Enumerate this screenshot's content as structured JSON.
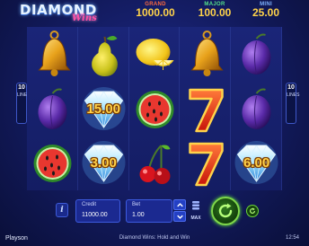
{
  "game": {
    "logo_main": "DIAMOND",
    "logo_sub": "Wins",
    "title": "Diamond Wins: Hold and Win",
    "provider": "Playson",
    "clock": "12:54"
  },
  "jackpots": {
    "grand": {
      "label": "GRAND",
      "value": "1000.00"
    },
    "major": {
      "label": "MAJOR",
      "value": "100.00"
    },
    "mini": {
      "label": "MINI",
      "value": "25.00"
    }
  },
  "lines": {
    "count": "10",
    "word": "LINES"
  },
  "reels": [
    [
      {
        "symbol": "bell-icon"
      },
      {
        "symbol": "plum-icon"
      },
      {
        "symbol": "watermelon-icon"
      }
    ],
    [
      {
        "symbol": "pear-icon"
      },
      {
        "symbol": "diamond-icon",
        "prize": "15.00"
      },
      {
        "symbol": "diamond-icon",
        "prize": "3.00"
      }
    ],
    [
      {
        "symbol": "lemon-icon"
      },
      {
        "symbol": "watermelon-icon"
      },
      {
        "symbol": "cherries-icon"
      }
    ],
    [
      {
        "symbol": "bell-icon"
      },
      {
        "symbol": "seven-icon"
      },
      {
        "symbol": "seven-icon"
      }
    ],
    [
      {
        "symbol": "plum-icon"
      },
      {
        "symbol": "plum-icon"
      },
      {
        "symbol": "diamond-icon",
        "prize": "6.00"
      }
    ]
  ],
  "controls": {
    "info_label": "i",
    "credit_label": "Credit",
    "credit_value": "11000.00",
    "bet_label": "Bet",
    "bet_value": "1.00",
    "max_label": "MAX"
  },
  "colors": {
    "background": "#121a5c",
    "jackpot_value": "#ffd34a",
    "grand_label": "#ff6a3d",
    "major_label": "#55e08a",
    "mini_label": "#7fb3ff",
    "spin_accent": "#7fd84a"
  }
}
